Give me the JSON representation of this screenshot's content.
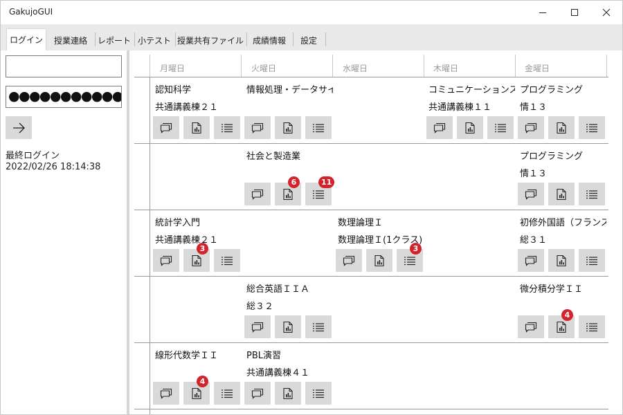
{
  "window": {
    "title": "GakujoGUI"
  },
  "tabs": [
    "ログイン",
    "授業連絡",
    "レポート",
    "小テスト",
    "授業共有ファイル",
    "成績情報",
    "設定"
  ],
  "login": {
    "username_value": "",
    "password_mask": "●●●●●●●●●●●●",
    "last_login_label": "最終ログイン",
    "last_login_value": "2022/02/26 18:14:38"
  },
  "days": [
    "月曜日",
    "火曜日",
    "水曜日",
    "木曜日",
    "金曜日"
  ],
  "periods": [
    [
      {
        "name": "認知科学",
        "room": "共通講義棟２１",
        "badges": [
          null,
          null,
          null
        ]
      },
      {
        "name": "情報処理・データサイエンス演習",
        "room": "",
        "badges": [
          null,
          null,
          null
        ]
      },
      null,
      {
        "name": "コミュニケーションスキル",
        "room": "共通講義棟１１",
        "badges": [
          null,
          null,
          null
        ]
      },
      {
        "name": "プログラミング",
        "room": "情１３",
        "badges": [
          null,
          null,
          null
        ]
      }
    ],
    [
      null,
      {
        "name": "社会と製造業",
        "room": "",
        "badges": [
          null,
          "6",
          "11"
        ]
      },
      null,
      null,
      {
        "name": "プログラミング",
        "room": "情１３",
        "badges": [
          null,
          null,
          null
        ]
      }
    ],
    [
      {
        "name": "統計学入門",
        "room": "共通講義棟２１",
        "badges": [
          null,
          "3",
          null
        ]
      },
      null,
      {
        "name": "数理論理Ｉ",
        "room": "数理論理Ｉ(1クラス)",
        "badges": [
          null,
          null,
          "3"
        ]
      },
      null,
      {
        "name": "初修外国語（フランス語）",
        "room": "総３１",
        "badges": [
          null,
          null,
          null
        ]
      }
    ],
    [
      null,
      {
        "name": "総合英語ＩＩＡ",
        "room": "総３２",
        "badges": [
          null,
          null,
          null
        ]
      },
      null,
      null,
      {
        "name": "微分積分学ＩＩ",
        "room": "",
        "badges": [
          null,
          "4",
          null
        ]
      }
    ],
    [
      {
        "name": "線形代数学ＩＩ",
        "room": "",
        "badges": [
          null,
          "4",
          null
        ]
      },
      {
        "name": "PBL演習",
        "room": "共通講義棟４１",
        "badges": [
          null,
          null,
          null
        ]
      },
      null,
      null,
      null
    ]
  ],
  "icons": {
    "class_contact": "message-icon",
    "report": "report-chart-icon",
    "quiz": "checklist-icon",
    "submit": "arrow-right-icon",
    "minimize": "minimize-icon",
    "maximize": "maximize-icon",
    "close": "close-icon"
  },
  "colors": {
    "badge": "#d3232b",
    "button": "#d9d9d9",
    "tabbar": "#e9e9e9"
  }
}
